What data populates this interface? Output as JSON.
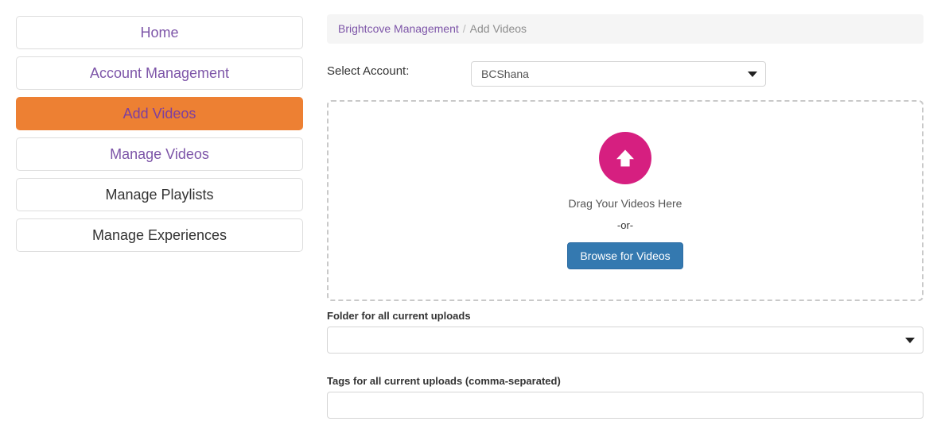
{
  "sidebar": {
    "items": [
      {
        "label": "Home",
        "state": "link"
      },
      {
        "label": "Account Management",
        "state": "link"
      },
      {
        "label": "Add Videos",
        "state": "active"
      },
      {
        "label": "Manage Videos",
        "state": "link"
      },
      {
        "label": "Manage Playlists",
        "state": "plain"
      },
      {
        "label": "Manage Experiences",
        "state": "plain"
      }
    ]
  },
  "breadcrumb": {
    "root": "Brightcove Management",
    "separator": "/",
    "current": "Add Videos"
  },
  "account": {
    "label": "Select Account:",
    "selected": "BCShana",
    "caret": "chevron-down-icon"
  },
  "dropzone": {
    "icon": "upload-arrow-icon",
    "drag_text": "Drag Your Videos Here",
    "or_text": "-or-",
    "browse_label": "Browse for Videos"
  },
  "folder": {
    "label": "Folder for all current uploads",
    "selected": "",
    "caret": "chevron-down-icon"
  },
  "tags": {
    "label": "Tags for all current uploads (comma-separated)",
    "value": "",
    "placeholder": ""
  },
  "colors": {
    "accent_purple": "#7d55a8",
    "active_orange": "#ed8033",
    "upload_pink": "#d61f80",
    "button_blue": "#3479b0",
    "breadcrumb_bg": "#f5f5f5",
    "border_gray": "#dddddd"
  }
}
